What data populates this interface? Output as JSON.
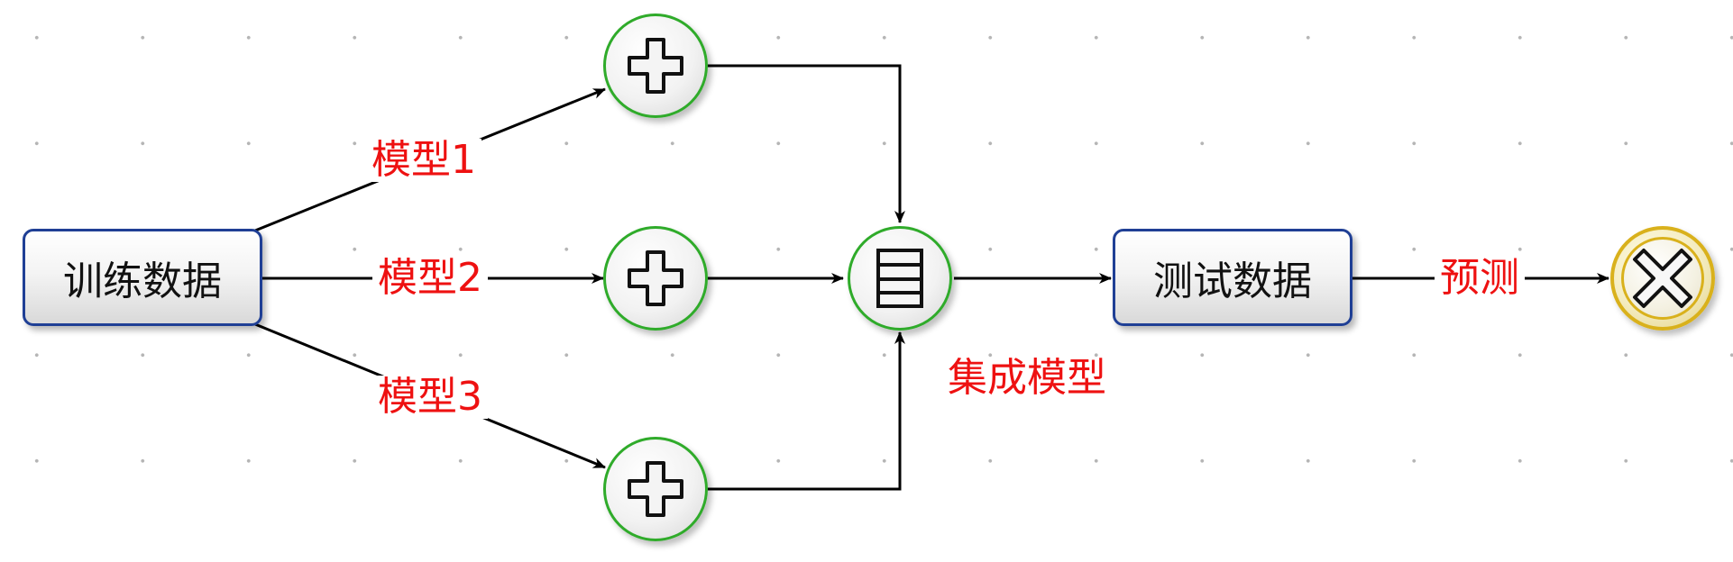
{
  "nodes": {
    "train_data": "训练数据",
    "test_data": "测试数据"
  },
  "labels": {
    "model1": "模型1",
    "model2": "模型2",
    "model3": "模型3",
    "ensemble": "集成模型",
    "predict": "预测"
  },
  "icons": {
    "gateway": "plus-icon",
    "merge": "document-list-icon",
    "end": "x-icon"
  },
  "colors": {
    "label_text": "#ee1111",
    "box_border": "#1f3f95",
    "gateway_border": "#2fab2a",
    "end_border": "#d9b11c",
    "arrow": "#000000"
  }
}
